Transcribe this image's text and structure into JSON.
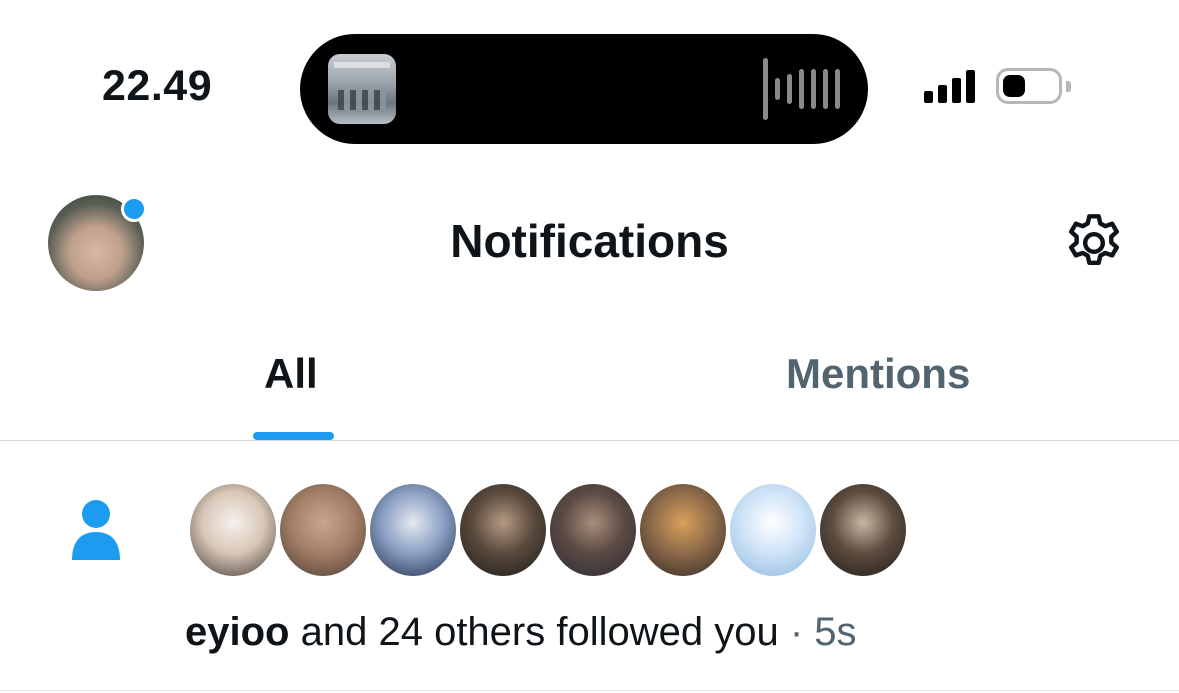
{
  "status_bar": {
    "time": "22.49",
    "icons": [
      "media-thumbnail",
      "audio-waveform-icon",
      "cellular-signal-icon",
      "battery-icon"
    ]
  },
  "header": {
    "title": "Notifications",
    "settings_icon": "gear-icon",
    "avatar_badge_color": "#1d9bf0"
  },
  "tabs": [
    {
      "label": "All",
      "selected": true
    },
    {
      "label": "Mentions",
      "selected": false
    }
  ],
  "colors": {
    "accent": "#1d9bf0",
    "text_primary": "#0f1419",
    "text_secondary": "#536471"
  },
  "notification": {
    "type_icon": "person-icon",
    "username": "eyioo",
    "message": "and 24 others followed you",
    "separator": "·",
    "time": "5s",
    "follower_avatars": [
      {
        "name": "follower-avatar-1",
        "colors": [
          "#f4f1ee",
          "#d9c7b7",
          "#3a3430"
        ]
      },
      {
        "name": "follower-avatar-2",
        "colors": [
          "#c9a58f",
          "#a47f68",
          "#4a3b33"
        ]
      },
      {
        "name": "follower-avatar-3",
        "colors": [
          "#e6e9ef",
          "#8aa0c4",
          "#1e2a44"
        ]
      },
      {
        "name": "follower-avatar-4",
        "colors": [
          "#b49a84",
          "#5a4a3d",
          "#1a1a1a"
        ]
      },
      {
        "name": "follower-avatar-5",
        "colors": [
          "#a98e7a",
          "#5b4a44",
          "#2b2a33"
        ]
      },
      {
        "name": "follower-avatar-6",
        "colors": [
          "#d9a05a",
          "#8e6b4a",
          "#2d2724"
        ]
      },
      {
        "name": "follower-avatar-7",
        "colors": [
          "#ffffff",
          "#cfe3f7",
          "#8bb7de"
        ]
      },
      {
        "name": "follower-avatar-8",
        "colors": [
          "#c8b6a4",
          "#5e4c3f",
          "#1e1b19"
        ]
      }
    ]
  }
}
